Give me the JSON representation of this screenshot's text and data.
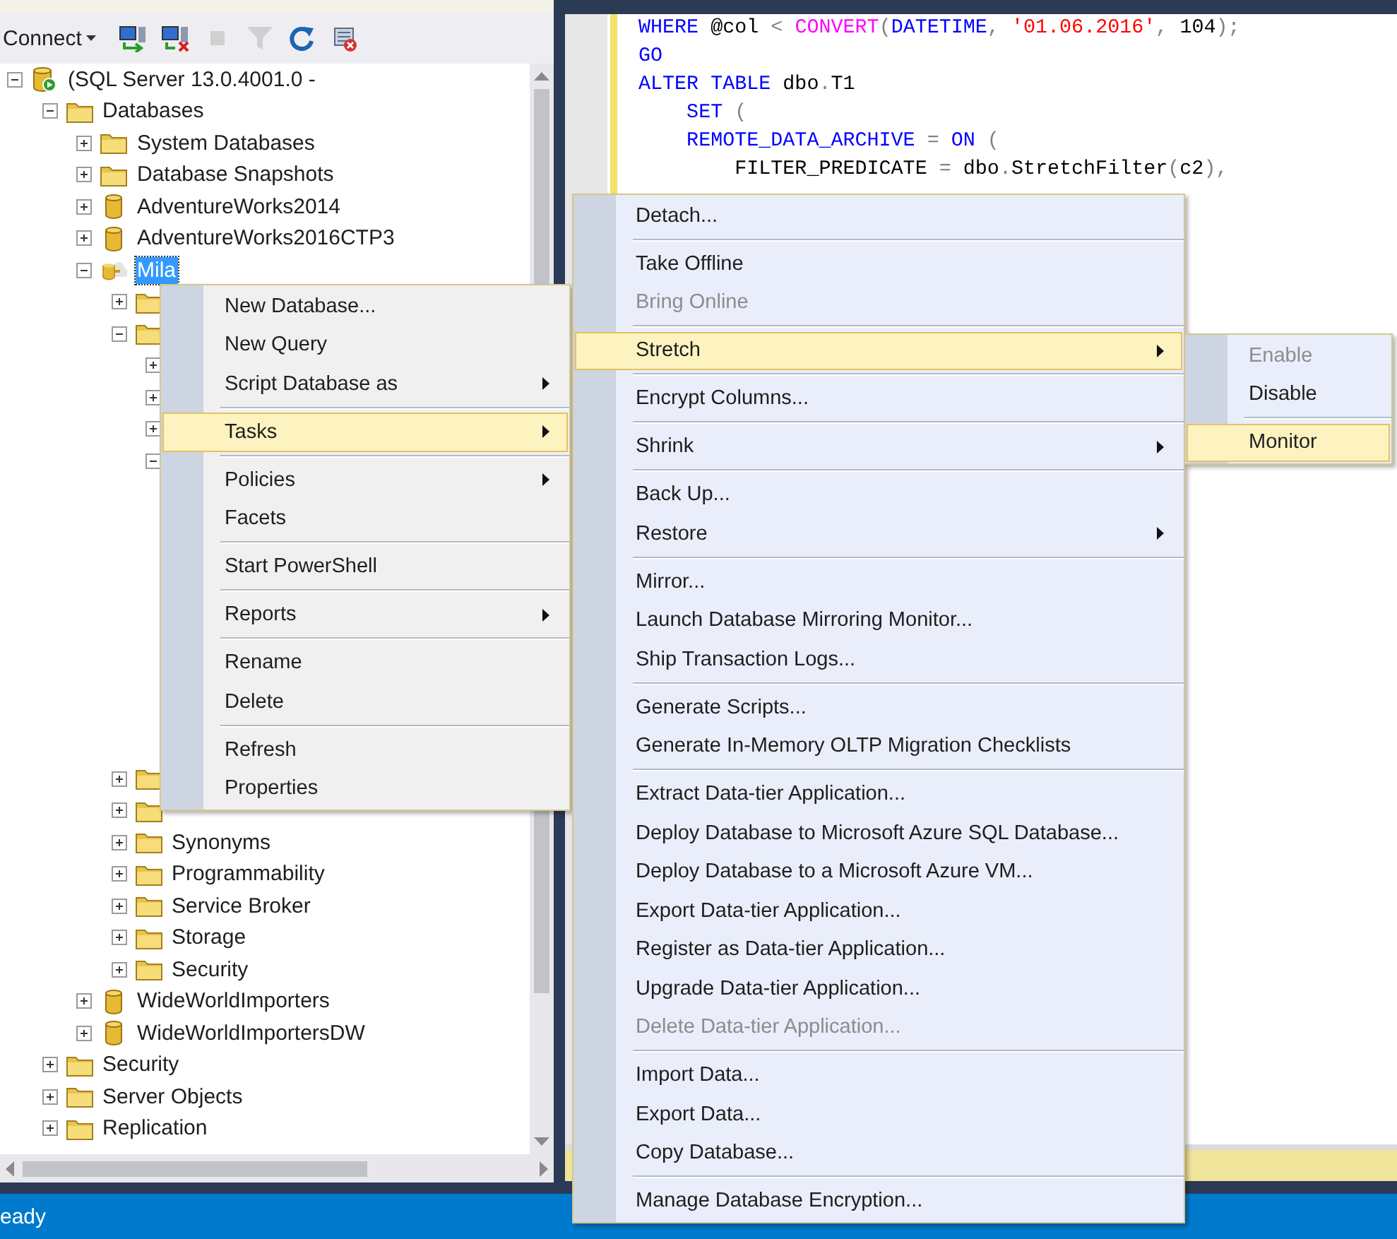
{
  "toolbar": {
    "connect_label": "Connect",
    "buttons": [
      {
        "kind": "connect",
        "disabled": false
      },
      {
        "kind": "disconnect",
        "disabled": false
      },
      {
        "kind": "stop",
        "disabled": true
      },
      {
        "kind": "filter",
        "disabled": true
      },
      {
        "kind": "refresh",
        "disabled": false
      },
      {
        "kind": "script",
        "disabled": false
      }
    ]
  },
  "tree": [
    {
      "kind": "server",
      "label": "(SQL Server 13.0.4001.0 -",
      "expanded": true,
      "selected": false,
      "children": [
        {
          "kind": "folder",
          "label": "Databases",
          "expanded": true,
          "selected": false,
          "children": [
            {
              "kind": "folder",
              "label": "System Databases",
              "expanded": false,
              "selected": false
            },
            {
              "kind": "folder",
              "label": "Database Snapshots",
              "expanded": false,
              "selected": false
            },
            {
              "kind": "database",
              "label": "AdventureWorks2014",
              "expanded": false,
              "selected": false
            },
            {
              "kind": "database",
              "label": "AdventureWorks2016CTP3",
              "expanded": false,
              "selected": false
            },
            {
              "kind": "stretch-database",
              "label": "Mila",
              "expanded": true,
              "selected": true,
              "children": [
                {
                  "kind": "folder",
                  "expanded": false
                },
                {
                  "kind": "folder",
                  "expanded": true,
                  "children": [
                    {
                      "expanded": false
                    },
                    {
                      "expanded": false
                    },
                    {
                      "expanded": false
                    },
                    {
                      "expanded": true
                    }
                  ]
                },
                {
                  "kind": "folder",
                  "expanded": false
                },
                {
                  "kind": "folder",
                  "expanded": false
                },
                {
                  "kind": "folder",
                  "label": "Synonyms",
                  "expanded": false,
                  "selected": false
                },
                {
                  "kind": "folder",
                  "label": "Programmability",
                  "expanded": false,
                  "selected": false
                },
                {
                  "kind": "folder",
                  "label": "Service Broker",
                  "expanded": false,
                  "selected": false
                },
                {
                  "kind": "folder",
                  "label": "Storage",
                  "expanded": false,
                  "selected": false
                },
                {
                  "kind": "folder",
                  "label": "Security",
                  "expanded": false,
                  "selected": false
                }
              ]
            },
            {
              "kind": "database",
              "label": "WideWorldImporters",
              "expanded": false,
              "selected": false
            },
            {
              "kind": "database",
              "label": "WideWorldImportersDW",
              "expanded": false,
              "selected": false
            }
          ]
        },
        {
          "kind": "folder",
          "label": "Security",
          "expanded": false,
          "selected": false
        },
        {
          "kind": "folder",
          "label": "Server Objects",
          "expanded": false,
          "selected": false
        },
        {
          "kind": "folder",
          "label": "Replication",
          "expanded": false,
          "selected": false
        }
      ]
    }
  ],
  "code_lines": [
    [
      {
        "kind": "keyword",
        "text": "WHERE"
      },
      {
        "kind": "plain",
        "text": " @col "
      },
      {
        "kind": "operator",
        "text": "< "
      },
      {
        "kind": "function",
        "text": "CONVERT"
      },
      {
        "kind": "operator",
        "text": "("
      },
      {
        "kind": "keyword",
        "text": "DATETIME"
      },
      {
        "kind": "operator",
        "text": ", "
      },
      {
        "kind": "string",
        "text": "'01.06.2016'"
      },
      {
        "kind": "operator",
        "text": ", "
      },
      {
        "kind": "plain",
        "text": "104"
      },
      {
        "kind": "operator",
        "text": ");"
      }
    ],
    [
      {
        "kind": "keyword",
        "text": "GO"
      }
    ],
    [
      {
        "kind": "keyword",
        "text": "ALTER TABLE"
      },
      {
        "kind": "plain",
        "text": " dbo"
      },
      {
        "kind": "operator",
        "text": "."
      },
      {
        "kind": "plain",
        "text": "T1"
      }
    ],
    [
      {
        "kind": "keyword",
        "text": "    SET"
      },
      {
        "kind": "operator",
        "text": " ("
      }
    ],
    [
      {
        "kind": "keyword",
        "text": "    REMOTE_DATA_ARCHIVE"
      },
      {
        "kind": "operator",
        "text": " = "
      },
      {
        "kind": "keyword",
        "text": "ON"
      },
      {
        "kind": "operator",
        "text": " ("
      }
    ],
    [
      {
        "kind": "plain",
        "text": "        FILTER_PREDICATE"
      },
      {
        "kind": "operator",
        "text": " = "
      },
      {
        "kind": "plain",
        "text": "dbo"
      },
      {
        "kind": "operator",
        "text": "."
      },
      {
        "kind": "plain",
        "text": "StretchFilter"
      },
      {
        "kind": "operator",
        "text": "("
      },
      {
        "kind": "plain",
        "text": "c2"
      },
      {
        "kind": "operator",
        "text": "),"
      }
    ]
  ],
  "context_menu": [
    {
      "kind": "item",
      "label": "New Database...",
      "selected": false,
      "disabled": false,
      "has_submenu": false
    },
    {
      "kind": "item",
      "label": "New Query",
      "selected": false,
      "disabled": false,
      "has_submenu": false
    },
    {
      "kind": "item",
      "label": "Script Database as",
      "selected": false,
      "disabled": false,
      "has_submenu": true
    },
    {
      "kind": "separator"
    },
    {
      "kind": "item",
      "label": "Tasks",
      "selected": true,
      "disabled": false,
      "has_submenu": true
    },
    {
      "kind": "separator"
    },
    {
      "kind": "item",
      "label": "Policies",
      "selected": false,
      "disabled": false,
      "has_submenu": true
    },
    {
      "kind": "item",
      "label": "Facets",
      "selected": false,
      "disabled": false,
      "has_submenu": false
    },
    {
      "kind": "separator"
    },
    {
      "kind": "item",
      "label": "Start PowerShell",
      "selected": false,
      "disabled": false,
      "has_submenu": false
    },
    {
      "kind": "separator"
    },
    {
      "kind": "item",
      "label": "Reports",
      "selected": false,
      "disabled": false,
      "has_submenu": true
    },
    {
      "kind": "separator"
    },
    {
      "kind": "item",
      "label": "Rename",
      "selected": false,
      "disabled": false,
      "has_submenu": false
    },
    {
      "kind": "item",
      "label": "Delete",
      "selected": false,
      "disabled": false,
      "has_submenu": false
    },
    {
      "kind": "separator"
    },
    {
      "kind": "item",
      "label": "Refresh",
      "selected": false,
      "disabled": false,
      "has_submenu": false
    },
    {
      "kind": "item",
      "label": "Properties",
      "selected": false,
      "disabled": false,
      "has_submenu": false
    }
  ],
  "tasks_submenu": [
    {
      "kind": "item",
      "label": "Detach...",
      "selected": false,
      "disabled": false,
      "has_submenu": false
    },
    {
      "kind": "separator"
    },
    {
      "kind": "item",
      "label": "Take Offline",
      "selected": false,
      "disabled": false,
      "has_submenu": false
    },
    {
      "kind": "item",
      "label": "Bring Online",
      "selected": false,
      "disabled": true,
      "has_submenu": false
    },
    {
      "kind": "separator"
    },
    {
      "kind": "item",
      "label": "Stretch",
      "selected": true,
      "disabled": false,
      "has_submenu": true
    },
    {
      "kind": "separator"
    },
    {
      "kind": "item",
      "label": "Encrypt Columns...",
      "selected": false,
      "disabled": false,
      "has_submenu": false
    },
    {
      "kind": "separator"
    },
    {
      "kind": "item",
      "label": "Shrink",
      "selected": false,
      "disabled": false,
      "has_submenu": true
    },
    {
      "kind": "separator"
    },
    {
      "kind": "item",
      "label": "Back Up...",
      "selected": false,
      "disabled": false,
      "has_submenu": false
    },
    {
      "kind": "item",
      "label": "Restore",
      "selected": false,
      "disabled": false,
      "has_submenu": true
    },
    {
      "kind": "separator"
    },
    {
      "kind": "item",
      "label": "Mirror...",
      "selected": false,
      "disabled": false,
      "has_submenu": false
    },
    {
      "kind": "item",
      "label": "Launch Database Mirroring Monitor...",
      "selected": false,
      "disabled": false,
      "has_submenu": false
    },
    {
      "kind": "item",
      "label": "Ship Transaction Logs...",
      "selected": false,
      "disabled": false,
      "has_submenu": false
    },
    {
      "kind": "separator"
    },
    {
      "kind": "item",
      "label": "Generate Scripts...",
      "selected": false,
      "disabled": false,
      "has_submenu": false
    },
    {
      "kind": "item",
      "label": "Generate In-Memory OLTP Migration Checklists",
      "selected": false,
      "disabled": false,
      "has_submenu": false
    },
    {
      "kind": "separator"
    },
    {
      "kind": "item",
      "label": "Extract Data-tier Application...",
      "selected": false,
      "disabled": false,
      "has_submenu": false
    },
    {
      "kind": "item",
      "label": "Deploy Database to Microsoft Azure SQL Database...",
      "selected": false,
      "disabled": false,
      "has_submenu": false
    },
    {
      "kind": "item",
      "label": "Deploy Database to a Microsoft Azure VM...",
      "selected": false,
      "disabled": false,
      "has_submenu": false
    },
    {
      "kind": "item",
      "label": "Export Data-tier Application...",
      "selected": false,
      "disabled": false,
      "has_submenu": false
    },
    {
      "kind": "item",
      "label": "Register as Data-tier Application...",
      "selected": false,
      "disabled": false,
      "has_submenu": false
    },
    {
      "kind": "item",
      "label": "Upgrade Data-tier Application...",
      "selected": false,
      "disabled": false,
      "has_submenu": false
    },
    {
      "kind": "item",
      "label": "Delete Data-tier Application...",
      "selected": false,
      "disabled": true,
      "has_submenu": false
    },
    {
      "kind": "separator"
    },
    {
      "kind": "item",
      "label": "Import Data...",
      "selected": false,
      "disabled": false,
      "has_submenu": false
    },
    {
      "kind": "item",
      "label": "Export Data...",
      "selected": false,
      "disabled": false,
      "has_submenu": false
    },
    {
      "kind": "item",
      "label": "Copy Database...",
      "selected": false,
      "disabled": false,
      "has_submenu": false
    },
    {
      "kind": "separator"
    },
    {
      "kind": "item",
      "label": "Manage Database Encryption...",
      "selected": false,
      "disabled": false,
      "has_submenu": false
    }
  ],
  "stretch_submenu": [
    {
      "kind": "item",
      "label": "Enable",
      "selected": false,
      "disabled": true,
      "has_submenu": false
    },
    {
      "kind": "item",
      "label": "Disable",
      "selected": false,
      "disabled": false,
      "has_submenu": false
    },
    {
      "kind": "separator"
    },
    {
      "kind": "item",
      "label": "Monitor",
      "selected": true,
      "disabled": false,
      "has_submenu": false
    }
  ],
  "status_bar": {
    "text": "eady"
  }
}
